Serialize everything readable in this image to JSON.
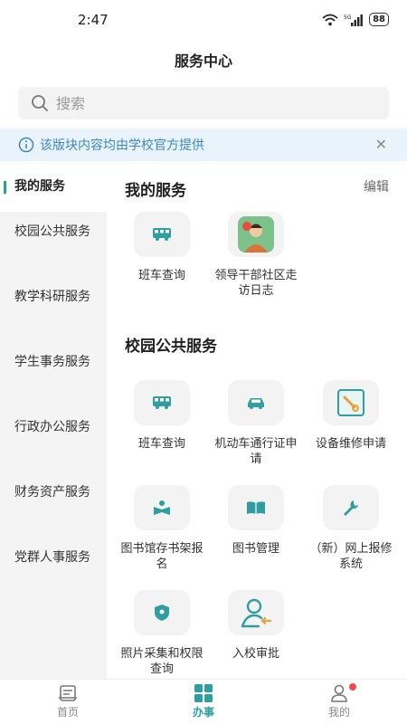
{
  "status_bar": {
    "time": "2:47",
    "network": "5G",
    "battery": "88"
  },
  "header": {
    "title": "服务中心"
  },
  "search": {
    "placeholder": "搜索"
  },
  "notice": {
    "text": "该版块内容均由学校官方提供"
  },
  "sidebar": {
    "items": [
      {
        "label": "我的服务",
        "active": true
      },
      {
        "label": "校园公共服务"
      },
      {
        "label": "教学科研服务"
      },
      {
        "label": "学生事务服务"
      },
      {
        "label": "行政办公服务"
      },
      {
        "label": "财务资产服务"
      },
      {
        "label": "党群人事服务"
      }
    ]
  },
  "my_services": {
    "title": "我的服务",
    "edit_label": "编辑",
    "items": [
      {
        "label": "班车查询",
        "icon": "bus-icon"
      },
      {
        "label": "领导干部社区走访日志",
        "icon": "leader-avatar-icon"
      }
    ]
  },
  "public_services": {
    "title": "校园公共服务",
    "items": [
      {
        "label": "班车查询",
        "icon": "bus-icon"
      },
      {
        "label": "机动车通行证申请",
        "icon": "car-icon"
      },
      {
        "label": "设备维修申请",
        "icon": "repair-request-icon"
      },
      {
        "label": "图书馆存书架报名",
        "icon": "book-reader-icon"
      },
      {
        "label": "图书管理",
        "icon": "open-book-icon"
      },
      {
        "label": "（新）网上报修系统",
        "icon": "wrench-icon"
      },
      {
        "label": "照片采集和权限查询",
        "icon": "shield-icon"
      },
      {
        "label": "入校审批",
        "icon": "user-entry-icon"
      }
    ]
  },
  "tabbar": {
    "items": [
      {
        "label": "首页",
        "icon": "home-icon"
      },
      {
        "label": "办事",
        "icon": "grid-icon",
        "active": true
      },
      {
        "label": "我的",
        "icon": "person-icon",
        "badge": true
      }
    ]
  },
  "colors": {
    "accent": "#2e9ea0",
    "notice_text": "#3f86c4",
    "notice_bg": "#e9f3fb",
    "badge": "#f04b4b"
  }
}
